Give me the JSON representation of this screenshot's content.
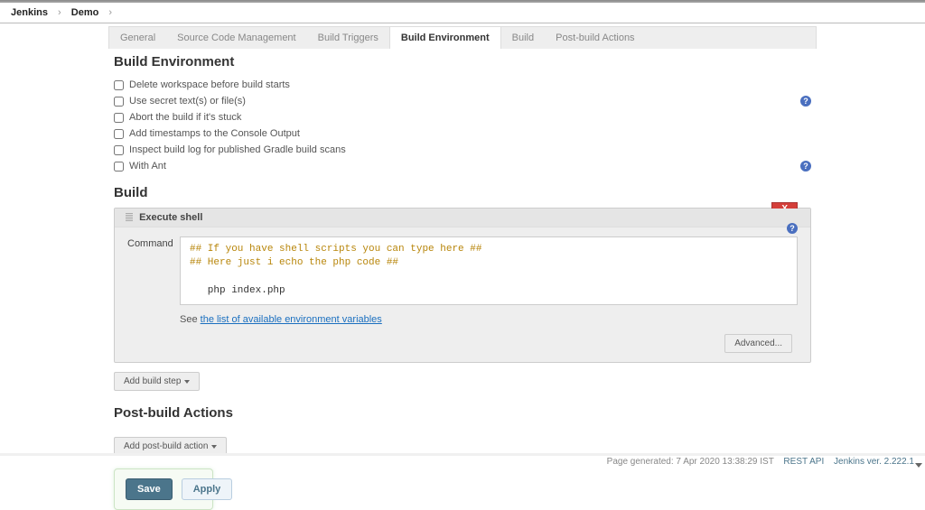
{
  "breadcrumb": {
    "root": "Jenkins",
    "project": "Demo"
  },
  "tabs": [
    {
      "label": "General"
    },
    {
      "label": "Source Code Management"
    },
    {
      "label": "Build Triggers"
    },
    {
      "label": "Build Environment",
      "active": true
    },
    {
      "label": "Build"
    },
    {
      "label": "Post-build Actions"
    }
  ],
  "sections": {
    "build_env": {
      "title": "Build Environment",
      "options": [
        {
          "label": "Delete workspace before build starts",
          "help": false
        },
        {
          "label": "Use secret text(s) or file(s)",
          "help": true
        },
        {
          "label": "Abort the build if it's stuck",
          "help": false
        },
        {
          "label": "Add timestamps to the Console Output",
          "help": false
        },
        {
          "label": "Inspect build log for published Gradle build scans",
          "help": false
        },
        {
          "label": "With Ant",
          "help": true
        }
      ]
    },
    "build": {
      "title": "Build",
      "step_title": "Execute shell",
      "command_label": "Command",
      "command_comment1": "## If you have shell scripts you can type here ##",
      "command_comment2": "## Here just i echo the php code ##",
      "command_body": "   php index.php",
      "see_text": "See ",
      "env_link": "the list of available environment variables",
      "close_x": "X",
      "advanced": "Advanced...",
      "add_step": "Add build step"
    },
    "post_build": {
      "title": "Post-build Actions",
      "add_action": "Add post-build action"
    }
  },
  "buttons": {
    "save": "Save",
    "apply": "Apply"
  },
  "footer": {
    "generated": "Page generated: 7 Apr 2020  13:38:29 IST",
    "rest_api": "REST API",
    "version": "Jenkins ver. 2.222.1"
  }
}
